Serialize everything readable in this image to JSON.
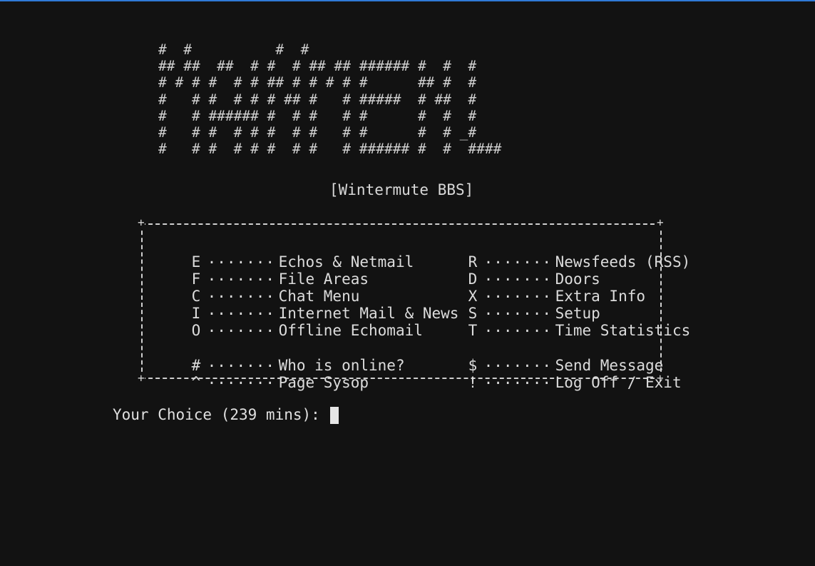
{
  "banner_art": [
    "#  #          #  #",
    "## ##  ##  # #  # ## ## ###### #  #  #",
    "# # # #  # # ## # # # # #      ## #  #",
    "#   # #  # # # ## #   # #####  # ##  #",
    "#   # ###### #  # #   # #      #  #  #",
    "#   # #  # # #  # #   # #      #  # _#",
    "#   # #  # # #  # #   # ###### #  #  ####"
  ],
  "subtitle": "[Wintermute BBS]",
  "box_corner": "+",
  "menu": {
    "left": [
      {
        "key": "E",
        "dots": ".........",
        "label": "Echos & Netmail"
      },
      {
        "key": "F",
        "dots": ".........",
        "label": "File Areas"
      },
      {
        "key": "C",
        "dots": ".........",
        "label": "Chat Menu"
      },
      {
        "key": "I",
        "dots": ".........",
        "label": "Internet Mail & News"
      },
      {
        "key": "O",
        "dots": ".........",
        "label": "Offline Echomail"
      },
      {
        "key": "#",
        "dots": ".........",
        "label": "Who is online?"
      },
      {
        "key": "^",
        "dots": ".........",
        "label": "Page Sysop"
      }
    ],
    "right": [
      {
        "key": "R",
        "dots": ".........",
        "label": "Newsfeeds (RSS)"
      },
      {
        "key": "D",
        "dots": ".........",
        "label": "Doors"
      },
      {
        "key": "X",
        "dots": ".........",
        "label": "Extra Info"
      },
      {
        "key": "S",
        "dots": ".........",
        "label": "Setup"
      },
      {
        "key": "T",
        "dots": ".........",
        "label": "Time Statistics"
      },
      {
        "key": "$",
        "dots": ".........",
        "label": "Send Message"
      },
      {
        "key": "!",
        "dots": ".........",
        "label": "Log Off / Exit"
      }
    ]
  },
  "prompt": {
    "text": "Your Choice (239 mins): "
  },
  "colors": {
    "background": "#121212",
    "text": "#d6d6d6",
    "window_edge": "#2f79d6"
  }
}
